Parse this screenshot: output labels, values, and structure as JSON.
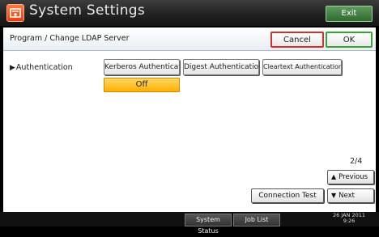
{
  "window": {
    "title": "System Settings",
    "exit_label": "Exit"
  },
  "header": {
    "title": "Program / Change LDAP Server",
    "cancel_label": "Cancel",
    "ok_label": "OK"
  },
  "authentication": {
    "label": "Authentication",
    "options": [
      {
        "label": "Kerberos Authentication",
        "selected": true
      },
      {
        "label": "Digest Authentication",
        "selected": false
      },
      {
        "label": "Cleartext Authentication",
        "selected": false
      }
    ],
    "value": "Off"
  },
  "paging": {
    "indicator": "2/4",
    "previous_label": "Previous",
    "next_label": "Next"
  },
  "connection_test_label": "Connection Test",
  "statusbar": {
    "system_status_label": "System Status",
    "job_list_label": "Job List",
    "date": "26 JAN  2011",
    "time": "9:26"
  },
  "colors": {
    "accent_orange": "#ffb000",
    "cancel_border": "#d53030",
    "ok_border": "#35a535",
    "exit_green": "#2f6a2f"
  }
}
